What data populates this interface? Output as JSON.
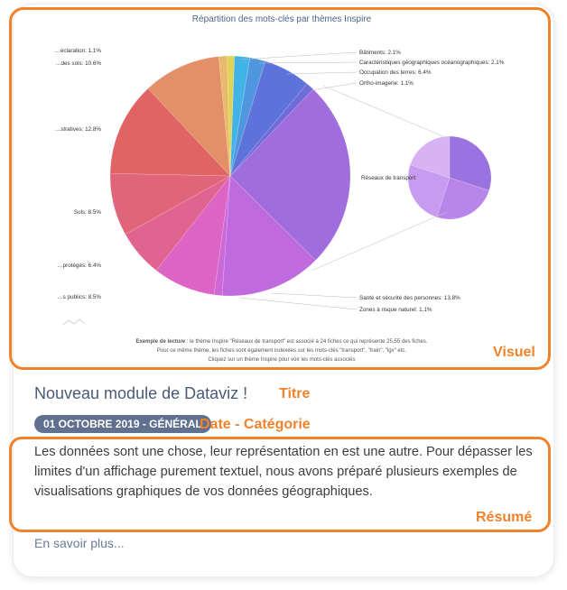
{
  "chart_data": {
    "type": "pie",
    "title": "Répartition des mots-clés par thèmes Inspire",
    "main_slices": [
      {
        "label": "Bâtiments: 2.1%",
        "value": 2.1,
        "color": "#42b3e6"
      },
      {
        "label": "Caractéristiques géographiques océanographiques: 2.1%",
        "value": 2.1,
        "color": "#4f96de"
      },
      {
        "label": "Occupation des terres: 6.4%",
        "value": 6.4,
        "color": "#5e72dc"
      },
      {
        "label": "Ortho-imagerie: 1.1%",
        "value": 1.1,
        "color": "#6f6bd9"
      },
      {
        "label": "Réseaux de transport",
        "value": 25.55,
        "color": "#a06ddd"
      },
      {
        "label": "Santé et sécurité des personnes: 13.8%",
        "value": 13.8,
        "color": "#c06ae0"
      },
      {
        "label": "Zones à risque naturel: 1.1%",
        "value": 1.1,
        "color": "#cc68d8"
      },
      {
        "label": "…s publics: 8.5%",
        "value": 8.5,
        "color": "#dc65c6"
      },
      {
        "label": "…protégés: 6.4%",
        "value": 6.4,
        "color": "#e0648f"
      },
      {
        "label": "Sols: 8.5%",
        "value": 8.5,
        "color": "#e06579"
      },
      {
        "label": "…stratives: 12.8%",
        "value": 12.8,
        "color": "#e06464"
      },
      {
        "label": "…des sols: 10.6%",
        "value": 10.6,
        "color": "#e39069"
      },
      {
        "label": "…éclaration: 1.1%",
        "value": 1.1,
        "color": "#e8b86b"
      },
      {
        "label": "",
        "value": 1.0,
        "color": "#e0d35a"
      }
    ],
    "detail_slices": [
      {
        "value": 30,
        "color": "#9b73e0"
      },
      {
        "value": 25,
        "color": "#b886ea"
      },
      {
        "value": 25,
        "color": "#c79cf0"
      },
      {
        "value": 20,
        "color": "#d7b2f5"
      }
    ],
    "caption": {
      "line1_bold": "Exemple de lecture",
      "line1": " : le thème Inspire \"Réseaux de transport\" est associé à 24 fiches ce qui représente 25,55 des fiches.",
      "line2": "Pour ce même thème, les fiches sont également indexées sur les mots-clés \"transport\", \"train\", \"lgv\" etc.",
      "line3": "Cliquez sur un thème Inspire pour voir les mots-clés associés"
    }
  },
  "annotations": {
    "visuel": "Visuel",
    "titre": "Titre",
    "date_categorie": "Date - Catégorie",
    "resume": "Résumé"
  },
  "article": {
    "title": "Nouveau module de Dataviz !",
    "badge": "01 OCTOBRE 2019 - GÉNÉRAL",
    "summary": "Les données sont une chose, leur représentation en est une autre. Pour dépasser les limites d'un affichage purement textuel, nous avons préparé plusieurs exemples de visualisations graphiques de vos données géographiques.",
    "more": "En savoir plus..."
  }
}
